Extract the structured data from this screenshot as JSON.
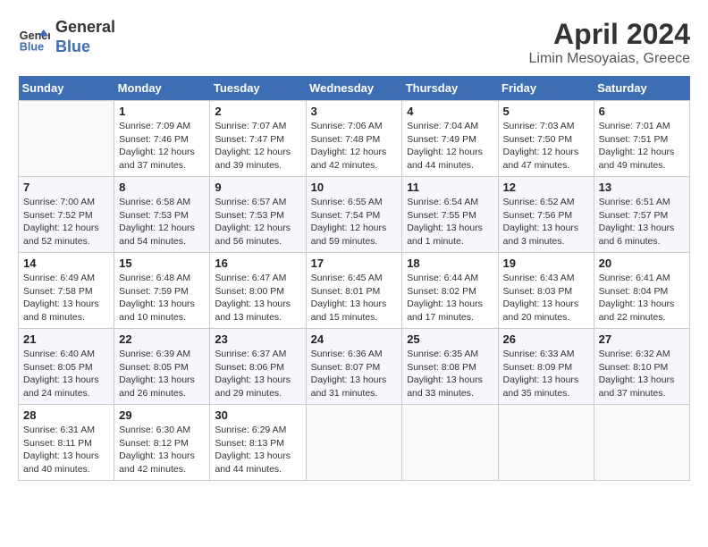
{
  "header": {
    "logo_line1": "General",
    "logo_line2": "Blue",
    "month": "April 2024",
    "location": "Limin Mesoyaias, Greece"
  },
  "weekdays": [
    "Sunday",
    "Monday",
    "Tuesday",
    "Wednesday",
    "Thursday",
    "Friday",
    "Saturday"
  ],
  "weeks": [
    [
      {
        "day": "",
        "info": ""
      },
      {
        "day": "1",
        "info": "Sunrise: 7:09 AM\nSunset: 7:46 PM\nDaylight: 12 hours\nand 37 minutes."
      },
      {
        "day": "2",
        "info": "Sunrise: 7:07 AM\nSunset: 7:47 PM\nDaylight: 12 hours\nand 39 minutes."
      },
      {
        "day": "3",
        "info": "Sunrise: 7:06 AM\nSunset: 7:48 PM\nDaylight: 12 hours\nand 42 minutes."
      },
      {
        "day": "4",
        "info": "Sunrise: 7:04 AM\nSunset: 7:49 PM\nDaylight: 12 hours\nand 44 minutes."
      },
      {
        "day": "5",
        "info": "Sunrise: 7:03 AM\nSunset: 7:50 PM\nDaylight: 12 hours\nand 47 minutes."
      },
      {
        "day": "6",
        "info": "Sunrise: 7:01 AM\nSunset: 7:51 PM\nDaylight: 12 hours\nand 49 minutes."
      }
    ],
    [
      {
        "day": "7",
        "info": "Sunrise: 7:00 AM\nSunset: 7:52 PM\nDaylight: 12 hours\nand 52 minutes."
      },
      {
        "day": "8",
        "info": "Sunrise: 6:58 AM\nSunset: 7:53 PM\nDaylight: 12 hours\nand 54 minutes."
      },
      {
        "day": "9",
        "info": "Sunrise: 6:57 AM\nSunset: 7:53 PM\nDaylight: 12 hours\nand 56 minutes."
      },
      {
        "day": "10",
        "info": "Sunrise: 6:55 AM\nSunset: 7:54 PM\nDaylight: 12 hours\nand 59 minutes."
      },
      {
        "day": "11",
        "info": "Sunrise: 6:54 AM\nSunset: 7:55 PM\nDaylight: 13 hours\nand 1 minute."
      },
      {
        "day": "12",
        "info": "Sunrise: 6:52 AM\nSunset: 7:56 PM\nDaylight: 13 hours\nand 3 minutes."
      },
      {
        "day": "13",
        "info": "Sunrise: 6:51 AM\nSunset: 7:57 PM\nDaylight: 13 hours\nand 6 minutes."
      }
    ],
    [
      {
        "day": "14",
        "info": "Sunrise: 6:49 AM\nSunset: 7:58 PM\nDaylight: 13 hours\nand 8 minutes."
      },
      {
        "day": "15",
        "info": "Sunrise: 6:48 AM\nSunset: 7:59 PM\nDaylight: 13 hours\nand 10 minutes."
      },
      {
        "day": "16",
        "info": "Sunrise: 6:47 AM\nSunset: 8:00 PM\nDaylight: 13 hours\nand 13 minutes."
      },
      {
        "day": "17",
        "info": "Sunrise: 6:45 AM\nSunset: 8:01 PM\nDaylight: 13 hours\nand 15 minutes."
      },
      {
        "day": "18",
        "info": "Sunrise: 6:44 AM\nSunset: 8:02 PM\nDaylight: 13 hours\nand 17 minutes."
      },
      {
        "day": "19",
        "info": "Sunrise: 6:43 AM\nSunset: 8:03 PM\nDaylight: 13 hours\nand 20 minutes."
      },
      {
        "day": "20",
        "info": "Sunrise: 6:41 AM\nSunset: 8:04 PM\nDaylight: 13 hours\nand 22 minutes."
      }
    ],
    [
      {
        "day": "21",
        "info": "Sunrise: 6:40 AM\nSunset: 8:05 PM\nDaylight: 13 hours\nand 24 minutes."
      },
      {
        "day": "22",
        "info": "Sunrise: 6:39 AM\nSunset: 8:05 PM\nDaylight: 13 hours\nand 26 minutes."
      },
      {
        "day": "23",
        "info": "Sunrise: 6:37 AM\nSunset: 8:06 PM\nDaylight: 13 hours\nand 29 minutes."
      },
      {
        "day": "24",
        "info": "Sunrise: 6:36 AM\nSunset: 8:07 PM\nDaylight: 13 hours\nand 31 minutes."
      },
      {
        "day": "25",
        "info": "Sunrise: 6:35 AM\nSunset: 8:08 PM\nDaylight: 13 hours\nand 33 minutes."
      },
      {
        "day": "26",
        "info": "Sunrise: 6:33 AM\nSunset: 8:09 PM\nDaylight: 13 hours\nand 35 minutes."
      },
      {
        "day": "27",
        "info": "Sunrise: 6:32 AM\nSunset: 8:10 PM\nDaylight: 13 hours\nand 37 minutes."
      }
    ],
    [
      {
        "day": "28",
        "info": "Sunrise: 6:31 AM\nSunset: 8:11 PM\nDaylight: 13 hours\nand 40 minutes."
      },
      {
        "day": "29",
        "info": "Sunrise: 6:30 AM\nSunset: 8:12 PM\nDaylight: 13 hours\nand 42 minutes."
      },
      {
        "day": "30",
        "info": "Sunrise: 6:29 AM\nSunset: 8:13 PM\nDaylight: 13 hours\nand 44 minutes."
      },
      {
        "day": "",
        "info": ""
      },
      {
        "day": "",
        "info": ""
      },
      {
        "day": "",
        "info": ""
      },
      {
        "day": "",
        "info": ""
      }
    ]
  ]
}
